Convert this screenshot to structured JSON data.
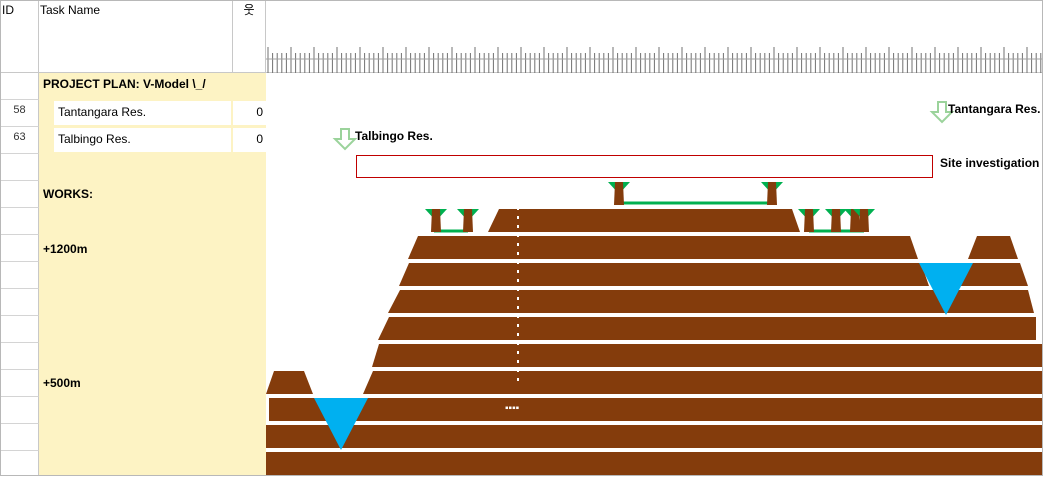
{
  "header": {
    "id": "ID",
    "task_name": "Task Name",
    "pct_icon": "웃"
  },
  "rows": {
    "r0": {
      "id": "",
      "name": "PROJECT PLAN: V-Model \\_/",
      "pct": ""
    },
    "r1": {
      "id": "58",
      "name": "Tantangara Res.",
      "pct": "0"
    },
    "r2": {
      "id": "63",
      "name": "Talbingo Res.",
      "pct": "0"
    },
    "r3": {
      "id": "",
      "name": "",
      "pct": ""
    },
    "r4": {
      "id": "",
      "name": "WORKS:",
      "pct": ""
    },
    "r5": {
      "id": "",
      "name": "",
      "pct": ""
    },
    "r6": {
      "id": "",
      "name": "+1200m",
      "pct": ""
    },
    "r7": {
      "id": "",
      "name": "",
      "pct": ""
    },
    "r8": {
      "id": "",
      "name": "",
      "pct": ""
    },
    "r9": {
      "id": "",
      "name": "",
      "pct": ""
    },
    "r10": {
      "id": "",
      "name": "",
      "pct": ""
    },
    "r11": {
      "id": "",
      "name": "+500m",
      "pct": ""
    },
    "r12": {
      "id": "",
      "name": "",
      "pct": ""
    },
    "r13": {
      "id": "",
      "name": "",
      "pct": ""
    },
    "r14": {
      "id": "",
      "name": "",
      "pct": ""
    }
  },
  "gantt": {
    "label_tantangara": "Tantangara Res.",
    "label_talbingo": "Talbingo Res.",
    "label_site": "Site investigation",
    "dots": "▪▪▪▪"
  },
  "colors": {
    "earth": "#843c0c",
    "water": "#00b0f0",
    "grid_fill": "#fdf3c4",
    "tree_green": "#00b050",
    "link_green": "#00b050",
    "site_border": "#c00000"
  },
  "icons": [
    "down-arrow-milestone-icon",
    "tree-icon"
  ]
}
